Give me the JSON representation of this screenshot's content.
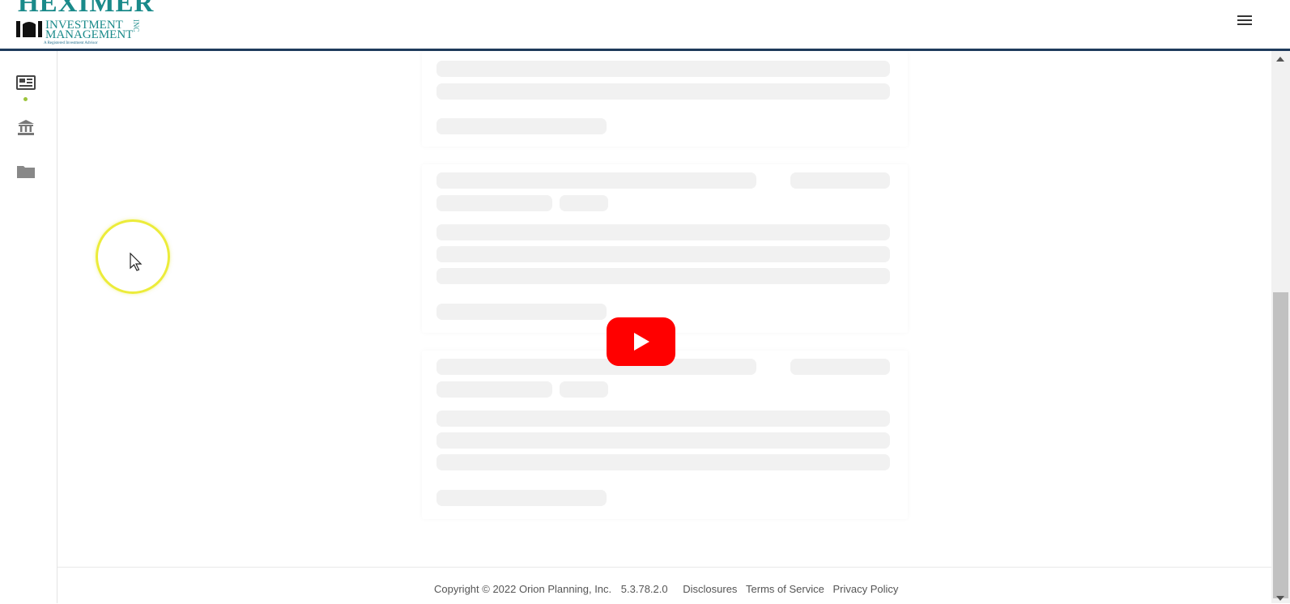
{
  "header": {
    "logo": {
      "name": "HEXIMER",
      "line1": "INVESTMENT",
      "line2": "MANAGEMENT",
      "suffix": "INC",
      "tagline": "A Registered Investment Advisor"
    },
    "menu_icon": "hamburger-menu-icon"
  },
  "sidebar": {
    "items": [
      {
        "icon": "newspaper-icon"
      },
      {
        "icon": "bank-icon"
      },
      {
        "icon": "folder-icon"
      }
    ]
  },
  "colors": {
    "brand_teal": "#1a8a8a",
    "header_border": "#1f3b5c",
    "skeleton": "#f1f1f1",
    "play_red": "#ff0000",
    "cursor_ring": "#ecec3a"
  },
  "footer": {
    "copyright": "Copyright © 2022 Orion Planning, Inc.",
    "version": "5.3.78.2.0",
    "links": [
      "Disclosures",
      "Terms of Service",
      "Privacy Policy"
    ]
  },
  "overlay": {
    "play_icon": "youtube-play-icon"
  }
}
